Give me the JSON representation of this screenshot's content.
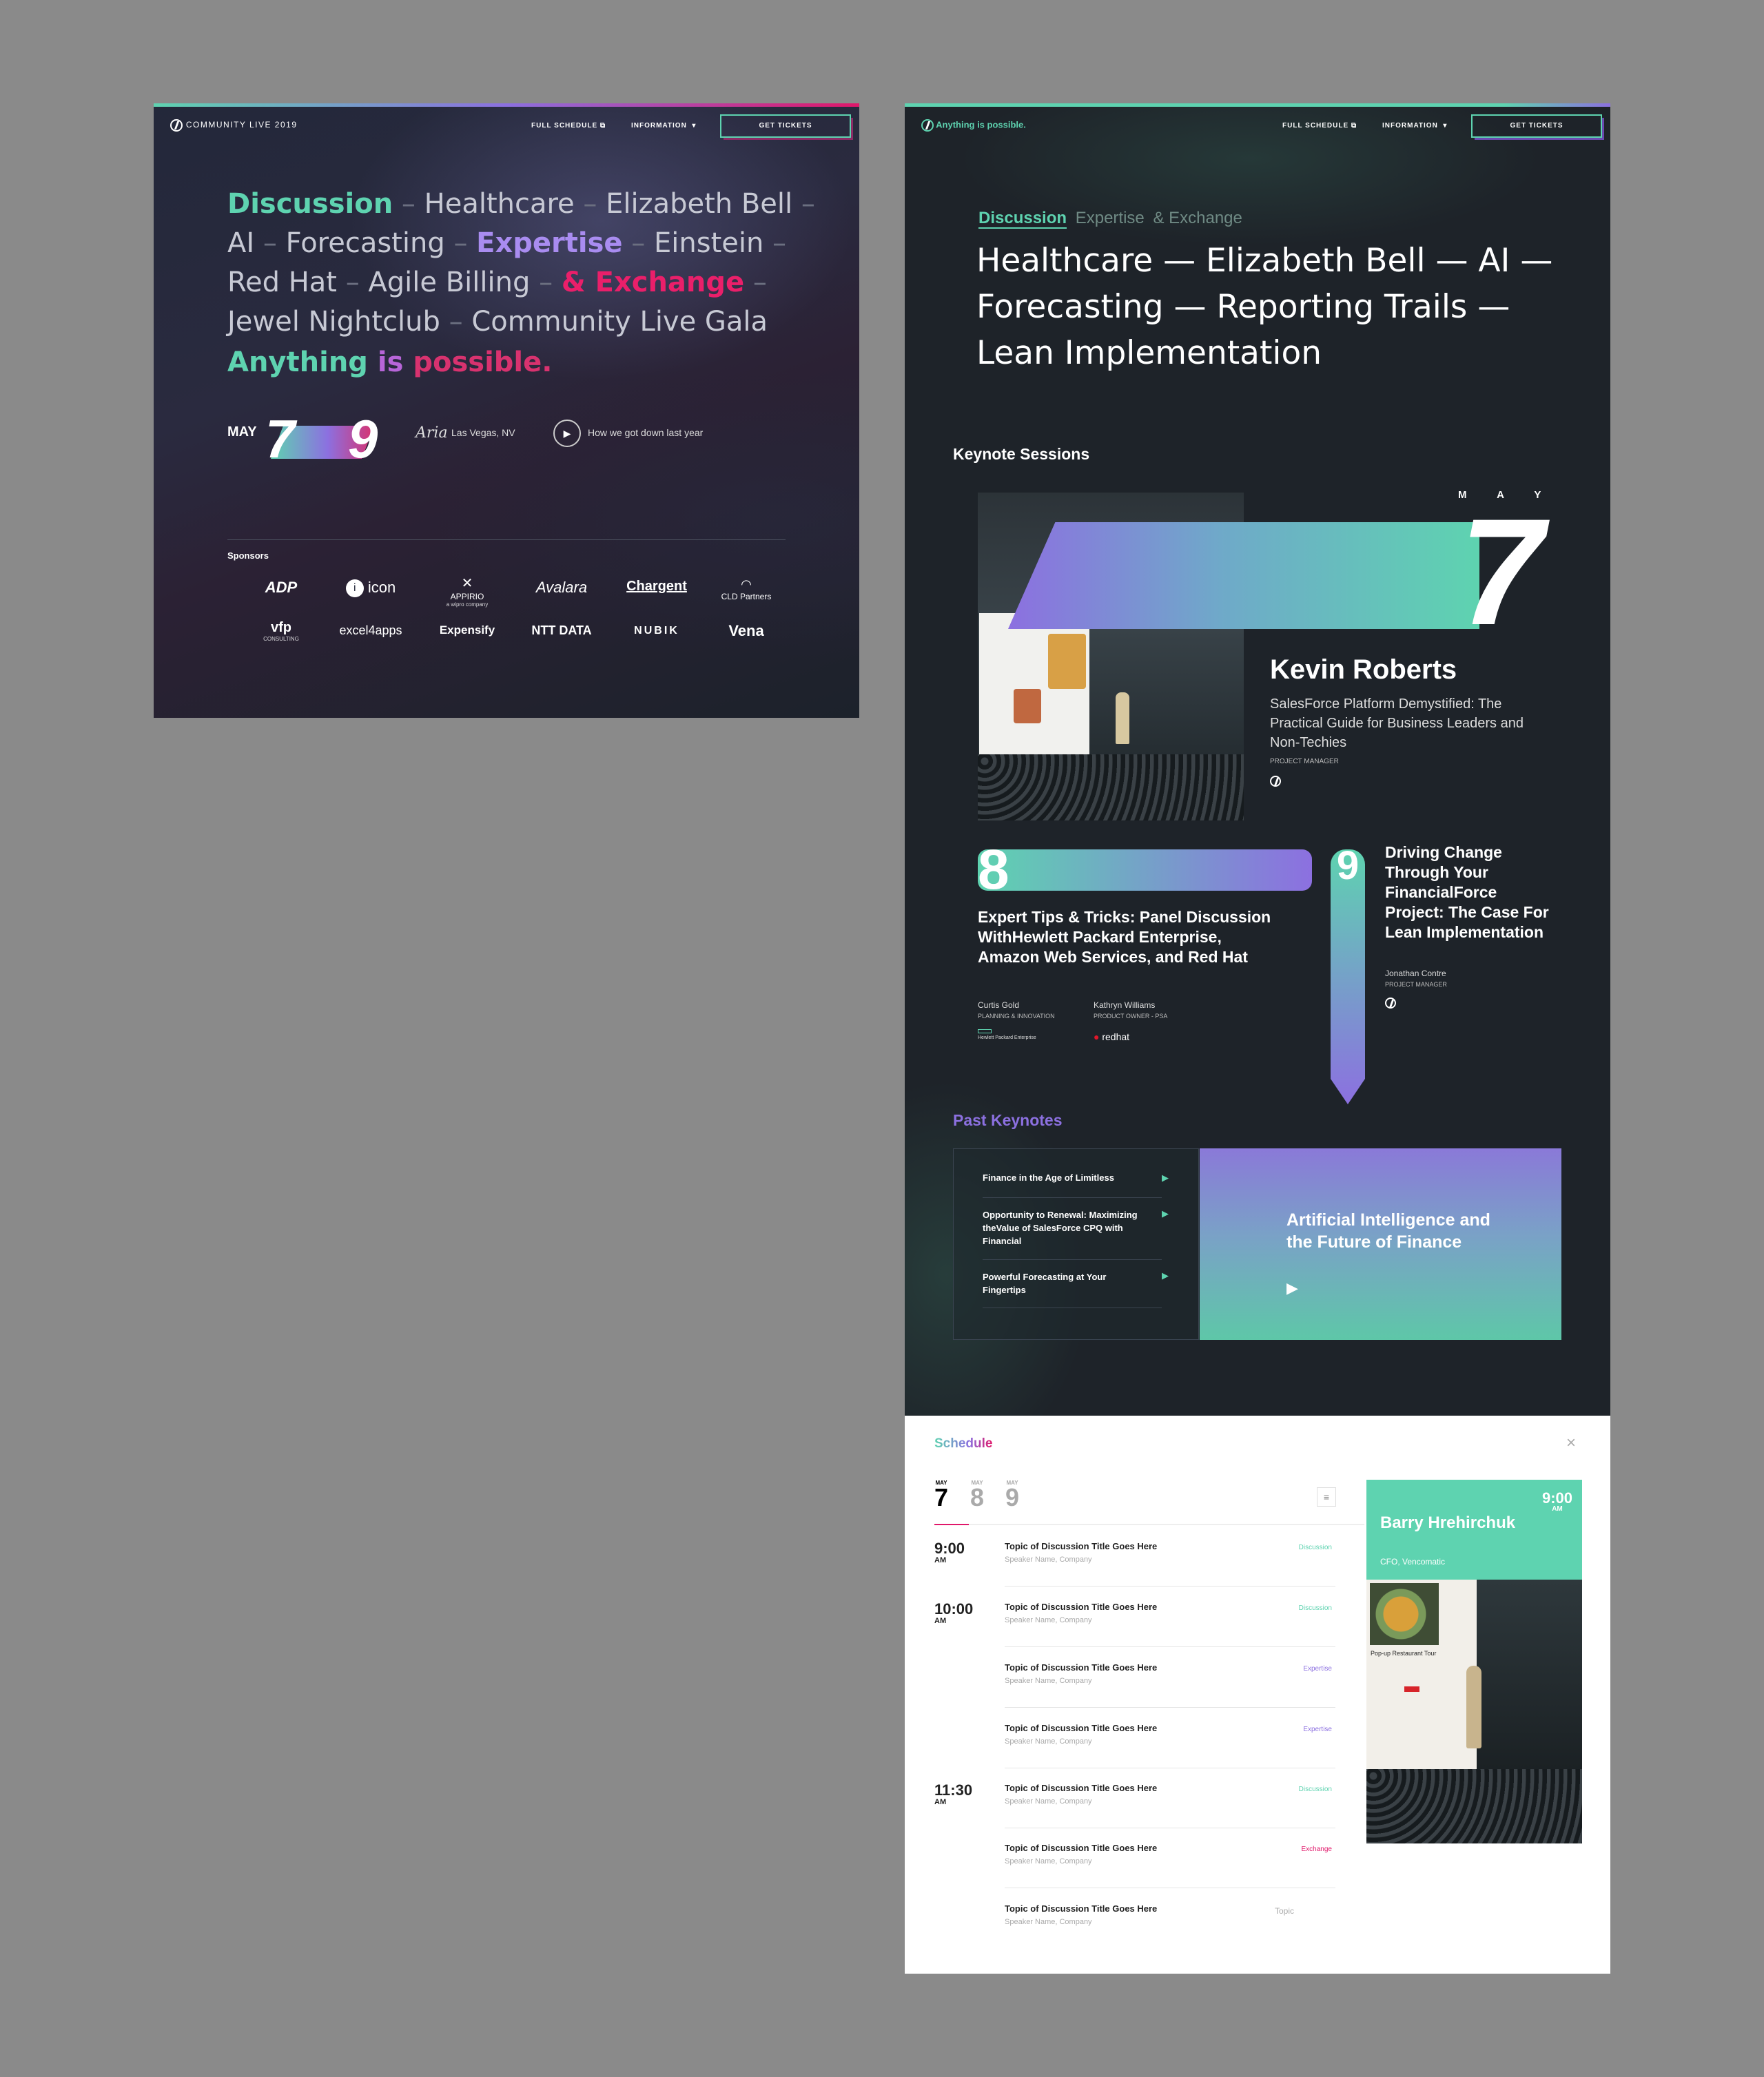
{
  "left": {
    "brand": "COMMUNITY LIVE 2019",
    "nav": {
      "schedule": "FULL SCHEDULE",
      "info": "INFORMATION",
      "tickets": "GET TICKETS"
    },
    "cloud": {
      "w1": "Discussion",
      "w2": "Healthcare",
      "w3": "Elizabeth Bell",
      "w4": "AI",
      "w5": "Forecasting",
      "w6": "Expertise",
      "w7": "Einstein",
      "w8": "Red Hat",
      "w9": "Agile Billing",
      "w10": "& Exchange",
      "w11": "Jewel Nightclub",
      "w12": "Community Live Gala",
      "tagline_a": "Anything",
      "tagline_b": "is",
      "tagline_c": "possible."
    },
    "dates": {
      "month": "MAY",
      "start": "7",
      "end": "9"
    },
    "venue": {
      "logo": "Aria",
      "location": "Las Vegas, NV"
    },
    "video": "How we got down last year",
    "sponsors_label": "Sponsors",
    "sponsors": [
      "ADP",
      "icon",
      "APPIRIO",
      "Avalara",
      "Chargent",
      "CLDPartners",
      "vfp",
      "excel4apps",
      "Expensify",
      "NTT DATA",
      "NUBIK",
      "Vena"
    ],
    "sponsor_notes": {
      "appirio": "a wipro company",
      "vfp": "CONSULTING",
      "cld": "CLD Partners"
    }
  },
  "right": {
    "brand": "Anything is possible.",
    "nav": {
      "schedule": "FULL SCHEDULE",
      "info": "INFORMATION",
      "tickets": "GET TICKETS"
    },
    "tabs": [
      "Discussion",
      "Expertise",
      "& Exchange"
    ],
    "headline_l1": "Healthcare — Elizabeth Bell — AI —",
    "headline_l2": "Forecasting — Reporting Trails —",
    "headline_l3": "Lean Implementation",
    "keynotes_title": "Keynote Sessions",
    "month_letters": [
      "M",
      "A",
      "Y"
    ],
    "day7": "7",
    "k1": {
      "name": "Kevin Roberts",
      "title": "SalesForce Platform Demystified: The Practical Guide for Business Leaders and Non-Techies",
      "role": "PROJECT MANAGER"
    },
    "day8": "8",
    "k2": {
      "title": "Expert Tips & Tricks: Panel Discussion WithHewlett Packard Enterprise, Amazon Web Services, and Red Hat",
      "s1name": "Curtis Gold",
      "s1role": "PLANNING & INNOVATION",
      "s2name": "Kathryn Williams",
      "s2role": "PRODUCT OWNER - PSA",
      "logo1": "Hewlett Packard Enterprise",
      "logo2": "redhat"
    },
    "day9": "9",
    "k3": {
      "title": "Driving Change Through Your FinancialForce Project: The Case For Lean Implementation",
      "speaker": "Jonathan Contre",
      "role": "PROJECT MANAGER"
    },
    "past_title": "Past Keynotes",
    "past": [
      {
        "title": "Finance in the Age of Limitless"
      },
      {
        "title": "Opportunity to Renewal: Maximizing theValue of SalesForce CPQ with Financial"
      },
      {
        "title": "Powerful Forecasting at Your Fingertips"
      }
    ],
    "feature": "Artificial Intelligence and the Future of Finance"
  },
  "schedule": {
    "title_a": "Schedule",
    "days": [
      {
        "m": "MAY",
        "d": "7"
      },
      {
        "m": "MAY",
        "d": "8"
      },
      {
        "m": "MAY",
        "d": "9"
      }
    ],
    "times": [
      {
        "t": "9:00",
        "ap": "AM"
      },
      {
        "t": "10:00",
        "ap": "AM"
      },
      {
        "t": "11:30",
        "ap": "AM"
      }
    ],
    "rows": [
      {
        "title": "Topic of Discussion Title Goes Here",
        "spk": "Speaker Name, Company",
        "tag": "Discussion"
      },
      {
        "title": "Topic of Discussion Title Goes Here",
        "spk": "Speaker Name, Company",
        "tag": "Discussion"
      },
      {
        "title": "Topic of Discussion Title Goes Here",
        "spk": "Speaker Name, Company",
        "tag": "Expertise"
      },
      {
        "title": "Topic of Discussion Title Goes Here",
        "spk": "Speaker Name, Company",
        "tag": "Expertise"
      },
      {
        "title": "Topic of Discussion Title Goes Here",
        "spk": "Speaker Name, Company",
        "tag": "Discussion"
      },
      {
        "title": "Topic of Discussion Title Goes Here",
        "spk": "Speaker Name, Company",
        "tag": "Exchange"
      },
      {
        "title": "Topic of Discussion Title Goes Here",
        "spk": "Speaker Name, Company",
        "tag": "Topic"
      }
    ],
    "card": {
      "time": "9:00",
      "ap": "AM",
      "name": "Barry Hrehirchuk",
      "role": "CFO, Vencomatic",
      "screen_title": "Pop-up Restaurant Tour"
    }
  },
  "colors": {
    "teal": "#5ed3b0",
    "purple": "#8c70e0",
    "magenta": "#e0176a",
    "dark": "#1e2329"
  }
}
